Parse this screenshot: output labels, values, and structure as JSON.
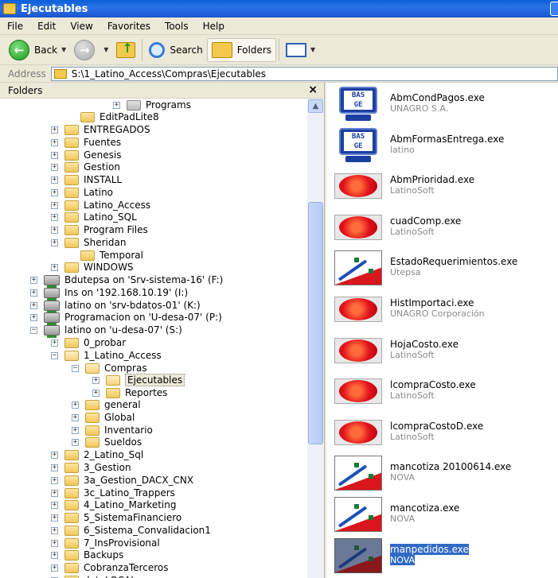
{
  "window": {
    "title": "Ejecutables"
  },
  "menu": [
    "File",
    "Edit",
    "View",
    "Favorites",
    "Tools",
    "Help"
  ],
  "toolbar": {
    "back_label": "Back",
    "search_label": "Search",
    "folders_label": "Folders"
  },
  "address": {
    "label": "Address",
    "value": "S:\\1_Latino_Access\\Compras\\Ejecutables"
  },
  "folders_pane": {
    "title": "Folders",
    "close": "×"
  },
  "tree": [
    {
      "label": "Programs",
      "expander": "+",
      "icon": "prog"
    },
    {
      "label": "EditPadLite8",
      "expander": "",
      "icon": "folder"
    },
    {
      "label": "ENTREGADOS",
      "expander": "+",
      "icon": "folder"
    },
    {
      "label": "Fuentes",
      "expander": "+",
      "icon": "folder"
    },
    {
      "label": "Genesis",
      "expander": "+",
      "icon": "folder"
    },
    {
      "label": "Gestion",
      "expander": "+",
      "icon": "folder"
    },
    {
      "label": "INSTALL",
      "expander": "+",
      "icon": "folder"
    },
    {
      "label": "Latino",
      "expander": "+",
      "icon": "folder"
    },
    {
      "label": "Latino_Access",
      "expander": "+",
      "icon": "folder"
    },
    {
      "label": "Latino_SQL",
      "expander": "+",
      "icon": "folder"
    },
    {
      "label": "Program Files",
      "expander": "+",
      "icon": "folder"
    },
    {
      "label": "Sheridan",
      "expander": "+",
      "icon": "folder"
    },
    {
      "label": "Temporal",
      "expander": "",
      "icon": "folder"
    },
    {
      "label": "WINDOWS",
      "expander": "+",
      "icon": "folder"
    },
    {
      "label": "Bdutepsa on 'Srv-sistema-16' (F:)",
      "expander": "+",
      "icon": "drive"
    },
    {
      "label": "Ins on '192.168.10.19' (I:)",
      "expander": "+",
      "icon": "drive"
    },
    {
      "label": "latino on 'srv-bdatos-01' (K:)",
      "expander": "+",
      "icon": "drive"
    },
    {
      "label": "Programacion on 'U-desa-07' (P:)",
      "expander": "+",
      "icon": "drive"
    },
    {
      "label": "latino on 'u-desa-07' (S:)",
      "expander": "−",
      "icon": "drive"
    },
    {
      "label": "0_probar",
      "expander": "+",
      "icon": "folder"
    },
    {
      "label": "1_Latino_Access",
      "expander": "−",
      "icon": "open"
    },
    {
      "label": "Compras",
      "expander": "−",
      "icon": "open"
    },
    {
      "label": "Ejecutables",
      "expander": "+",
      "icon": "open",
      "selected": true
    },
    {
      "label": "Reportes",
      "expander": "+",
      "icon": "folder"
    },
    {
      "label": "general",
      "expander": "+",
      "icon": "folder"
    },
    {
      "label": "Global",
      "expander": "+",
      "icon": "folder"
    },
    {
      "label": "Inventario",
      "expander": "+",
      "icon": "folder"
    },
    {
      "label": "Sueldos",
      "expander": "+",
      "icon": "folder"
    },
    {
      "label": "2_Latino_Sql",
      "expander": "+",
      "icon": "folder"
    },
    {
      "label": "3_Gestion",
      "expander": "+",
      "icon": "folder"
    },
    {
      "label": "3a_Gestion_DACX_CNX",
      "expander": "+",
      "icon": "folder"
    },
    {
      "label": "3c_Latino_Trappers",
      "expander": "+",
      "icon": "folder"
    },
    {
      "label": "4_Latino_Marketing",
      "expander": "+",
      "icon": "folder"
    },
    {
      "label": "5_SistemaFinanciero",
      "expander": "+",
      "icon": "folder"
    },
    {
      "label": "6_Sistema_Convalidacion1",
      "expander": "+",
      "icon": "folder"
    },
    {
      "label": "7_InsProvisional",
      "expander": "+",
      "icon": "folder"
    },
    {
      "label": "Backups",
      "expander": "+",
      "icon": "folder"
    },
    {
      "label": "CobranzaTerceros",
      "expander": "+",
      "icon": "folder"
    },
    {
      "label": "datoLOCAL",
      "expander": "+",
      "icon": "folder"
    }
  ],
  "files": [
    {
      "name": "AbmCondPagos.exe",
      "desc": "UNAGRO S.A.",
      "icon": "basge"
    },
    {
      "name": "AbmFormasEntrega.exe",
      "desc": "latino",
      "icon": "basge"
    },
    {
      "name": "AbmPrioridad.exe",
      "desc": "LatinoSoft",
      "icon": "latino"
    },
    {
      "name": "cuadComp.exe",
      "desc": "LatinoSoft",
      "icon": "latino"
    },
    {
      "name": "EstadoRequerimientos.exe",
      "desc": "Utepsa",
      "icon": "nova"
    },
    {
      "name": "HistImportaci.exe",
      "desc": "UNAGRO Corporación",
      "icon": "latino"
    },
    {
      "name": "HojaCosto.exe",
      "desc": "LatinoSoft",
      "icon": "latino"
    },
    {
      "name": "lcompraCosto.exe",
      "desc": "LatinoSoft",
      "icon": "latino"
    },
    {
      "name": "lcompraCostoD.exe",
      "desc": "LatinoSoft",
      "icon": "latino"
    },
    {
      "name": "mancotiza 20100614.exe",
      "desc": "NOVA",
      "icon": "nova"
    },
    {
      "name": "mancotiza.exe",
      "desc": "NOVA",
      "icon": "nova"
    },
    {
      "name": "manpedidos.exe",
      "desc": "NOVA",
      "icon": "nova",
      "selected": true
    }
  ],
  "icons": {
    "basge": "basge-app-icon",
    "latino": "latinosoft-app-icon",
    "nova": "nova-app-icon"
  }
}
